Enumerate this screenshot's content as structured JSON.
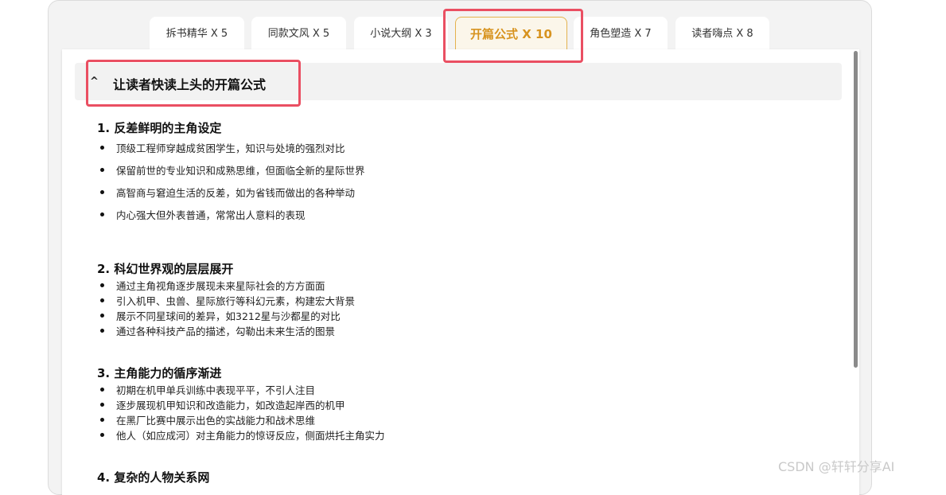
{
  "tabs": [
    {
      "label": "拆书精华 X 5"
    },
    {
      "label": "同款文风 X 5"
    },
    {
      "label": "小说大纲 X 3"
    },
    {
      "label": "开篇公式 X 10",
      "active": true
    },
    {
      "label": "角色塑造 X 7"
    },
    {
      "label": "读者嗨点 X 8"
    }
  ],
  "section": {
    "toggle_icon": "^",
    "title": "让读者快读上头的开篇公式"
  },
  "items": [
    {
      "title": "1. 反差鲜明的主角设定",
      "bullets": [
        "顶级工程师穿越成贫困学生，知识与处境的强烈对比",
        "保留前世的专业知识和成熟思维，但面临全新的星际世界",
        "高智商与窘迫生活的反差，如为省钱而做出的各种举动",
        "内心强大但外表普通，常常出人意料的表现"
      ]
    },
    {
      "title": "2. 科幻世界观的层层展开",
      "bullets": [
        "通过主角视角逐步展现未来星际社会的方方面面",
        "引入机甲、虫兽、星际旅行等科幻元素，构建宏大背景",
        "展示不同星球间的差异，如3212星与沙都星的对比",
        "通过各种科技产品的描述，勾勒出未来生活的图景"
      ]
    },
    {
      "title": "3. 主角能力的循序渐进",
      "bullets": [
        "初期在机甲单兵训练中表现平平，不引人注目",
        "逐步展现机甲知识和改造能力，如改造起岸西的机甲",
        "在黑厂比赛中展示出色的实战能力和战术思维",
        "他人（如应成河）对主角能力的惊讶反应，侧面烘托主角实力"
      ]
    },
    {
      "title": "4. 复杂的人物关系网",
      "bullets": []
    }
  ],
  "watermark": "CSDN @轩轩分享AI",
  "colors": {
    "active_tab_text": "#d7931f",
    "active_tab_border": "#e4b24e",
    "annotation_box": "#ea4f62"
  }
}
